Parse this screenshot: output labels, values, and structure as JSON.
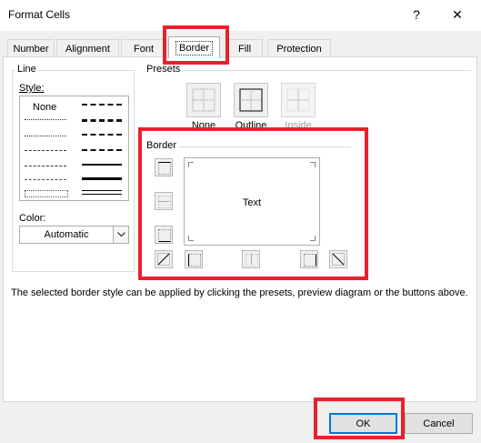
{
  "window": {
    "title": "Format Cells",
    "help": "?",
    "close": "✕"
  },
  "tabs": [
    {
      "label": "Number"
    },
    {
      "label": "Alignment"
    },
    {
      "label": "Font"
    },
    {
      "label": "Border"
    },
    {
      "label": "Fill"
    },
    {
      "label": "Protection"
    }
  ],
  "line": {
    "group_label": "Line",
    "style_label": "Style:",
    "none_label": "None",
    "color_label": "Color:",
    "color_value": "Automatic"
  },
  "presets": {
    "group_label": "Presets",
    "items": [
      {
        "label": "None"
      },
      {
        "label": "Outline"
      },
      {
        "label": "Inside"
      }
    ]
  },
  "border": {
    "group_label": "Border",
    "preview_text": "Text"
  },
  "note": "The selected border style can be applied by clicking the presets, preview diagram or the buttons above.",
  "buttons": {
    "ok": "OK",
    "cancel": "Cancel"
  },
  "colors": {
    "highlight": "#e8212c",
    "default_button": "#0078d7"
  }
}
